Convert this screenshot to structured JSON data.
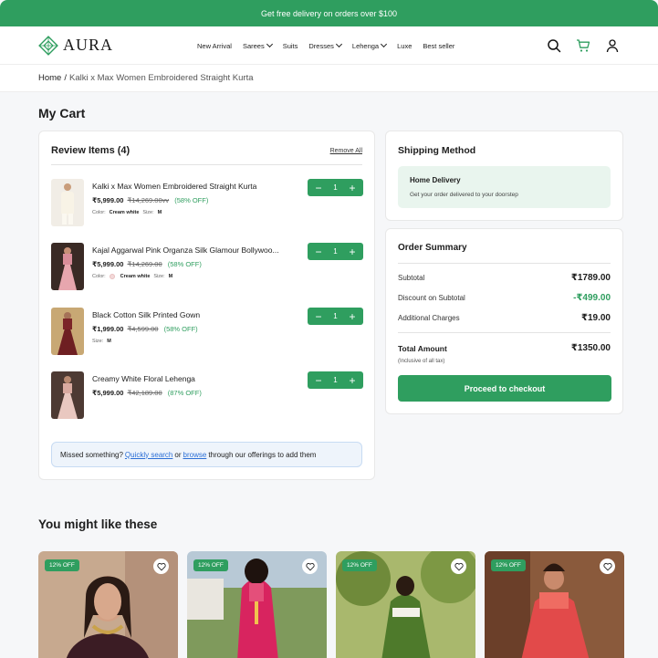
{
  "promo": "Get free delivery on orders over $100",
  "brand": "AURA",
  "nav": [
    {
      "label": "New Arrival",
      "dropdown": false
    },
    {
      "label": "Sarees",
      "dropdown": true
    },
    {
      "label": "Suits",
      "dropdown": false
    },
    {
      "label": "Dresses",
      "dropdown": true
    },
    {
      "label": "Lehenga",
      "dropdown": true
    },
    {
      "label": "Luxe",
      "dropdown": false
    },
    {
      "label": "Best seller",
      "dropdown": false
    }
  ],
  "header_icons": [
    "search-icon",
    "cart-icon",
    "user-icon"
  ],
  "breadcrumb": {
    "home": "Home",
    "sep": "/",
    "current": "Kalki x Max Women Embroidered Straight Kurta"
  },
  "page_title": "My Cart",
  "review": {
    "title": "Review Items (4)",
    "remove_all": "Remove All",
    "items": [
      {
        "name": "Kalki x Max Women Embroidered Straight Kurta",
        "price": "₹5,999.00",
        "was": "₹14,269.00vv",
        "off": "(58% OFF)",
        "color_label": "Color:",
        "color": "Cream white",
        "size_label": "Size:",
        "size": "M",
        "qty": "1"
      },
      {
        "name": "Kajal Aggarwal Pink Organza Silk Glamour Bollywoo...",
        "price": "₹5,999.00",
        "was": "₹14,269.00",
        "off": "(58% OFF)",
        "color_label": "Color:",
        "color": "Cream white",
        "size_label": "Size:",
        "size": "M",
        "qty": "1"
      },
      {
        "name": "Black Cotton Silk Printed Gown",
        "price": "₹1,999.00",
        "was": "₹4,599.00",
        "off": "(58% OFF)",
        "size_label": "Size:",
        "size": "M",
        "qty": "1"
      },
      {
        "name": "Creamy White Floral Lehenga",
        "price": "₹5,999.00",
        "was": "₹42,189.00",
        "off": "(87% OFF)",
        "qty": "1"
      }
    ],
    "missed": {
      "prefix": "Missed something?",
      "link1": "Quickly search",
      "or": "or",
      "link2": "browse",
      "suffix": "through our offerings to add them"
    }
  },
  "shipping": {
    "title": "Shipping Method",
    "option_title": "Home Delivery",
    "option_desc": "Get your order delivered to your doorstep"
  },
  "summary": {
    "title": "Order Summary",
    "subtotal_label": "Subtotal",
    "subtotal": "₹1789.00",
    "discount_label": "Discount on Subtotal",
    "discount": "-₹499.00",
    "charges_label": "Additional Charges",
    "charges": "₹19.00",
    "total_label": "Total Amount",
    "total": "₹1350.00",
    "total_note": "(Inclusive of all tax)",
    "checkout": "Proceed to checkout"
  },
  "recommend": {
    "title": "You might like these",
    "products": [
      {
        "badge": "12% OFF"
      },
      {
        "badge": "12% OFF"
      },
      {
        "badge": "12% OFF"
      },
      {
        "badge": "12% OFF"
      }
    ]
  },
  "colors": {
    "accent": "#2f9e5f",
    "link": "#2c6fd6"
  }
}
